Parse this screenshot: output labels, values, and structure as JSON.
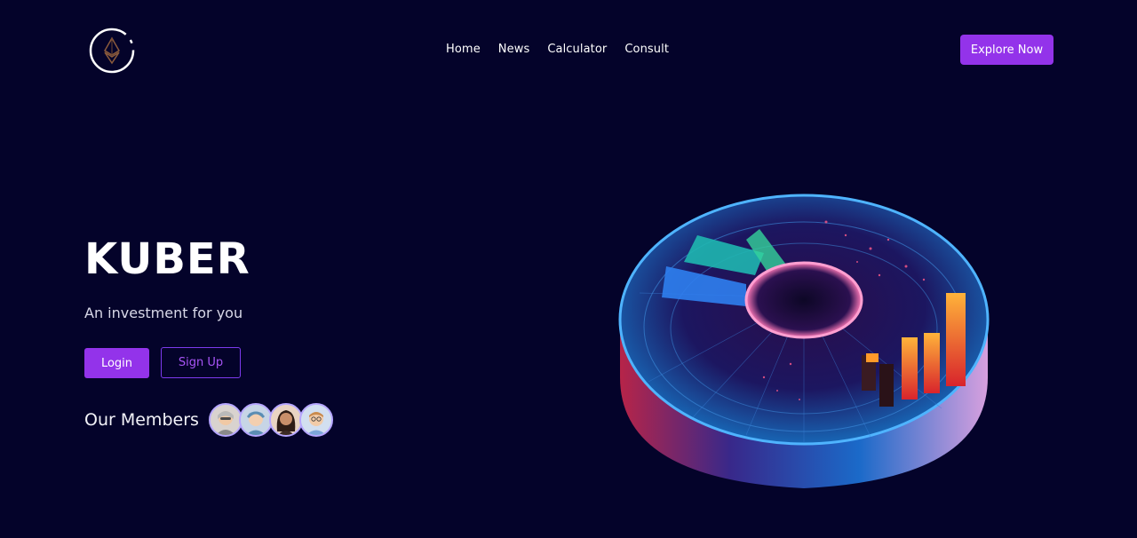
{
  "header": {
    "logo_icon": "ethereum-ring-logo-icon",
    "nav": [
      {
        "label": "Home"
      },
      {
        "label": "News"
      },
      {
        "label": "Calculator"
      },
      {
        "label": "Consult"
      }
    ],
    "cta_label": "Explore Now"
  },
  "hero": {
    "title": "KUBER",
    "tagline": "An investment for you",
    "login_label": "Login",
    "signup_label": "Sign Up",
    "members_label": "Our Members",
    "avatars": [
      "avatar-1",
      "avatar-2",
      "avatar-3",
      "avatar-4"
    ],
    "illustration_icon": "3d-chart-disc-icon"
  },
  "colors": {
    "background": "#04032a",
    "accent": "#9333ea",
    "accent_outline": "#7c3aed",
    "text": "#ffffff"
  }
}
